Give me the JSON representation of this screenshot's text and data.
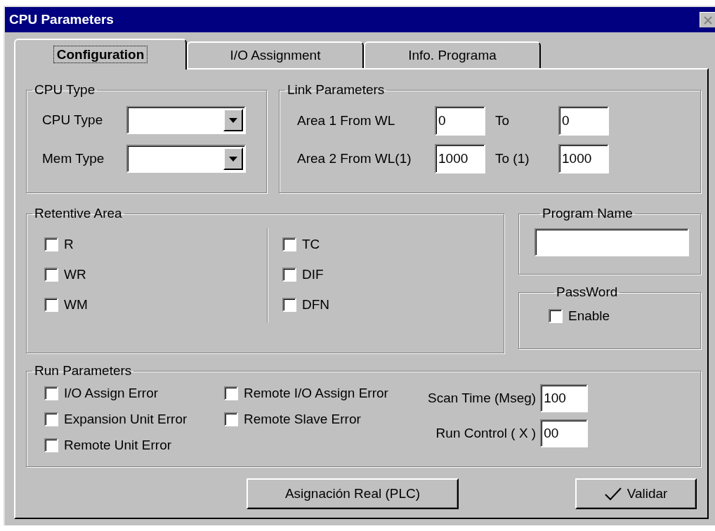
{
  "window": {
    "title": "CPU Parameters"
  },
  "tabs": [
    {
      "label": "Configuration",
      "selected": true
    },
    {
      "label": "I/O Assignment",
      "selected": false
    },
    {
      "label": "Info. Programa",
      "selected": false
    }
  ],
  "cpu_type": {
    "title": "CPU Type",
    "fields": [
      {
        "label": "CPU Type"
      },
      {
        "label": "Mem Type"
      }
    ]
  },
  "link_parameters": {
    "title": "Link Parameters",
    "rows": [
      {
        "label": "Area 1 From WL",
        "from": "0",
        "to_label": "To",
        "to": "0"
      },
      {
        "label": "Area 2 From WL(1)",
        "from": "1000",
        "to_label": "To (1)",
        "to": "1000"
      }
    ]
  },
  "retentive_area": {
    "title": "Retentive Area",
    "columns": [
      [
        {
          "label": "R",
          "checked": false
        },
        {
          "label": "WR",
          "checked": false
        },
        {
          "label": "WM",
          "checked": false
        }
      ],
      [
        {
          "label": "TC",
          "checked": false
        },
        {
          "label": "DIF",
          "checked": false
        },
        {
          "label": "DFN",
          "checked": false
        }
      ]
    ]
  },
  "program_name": {
    "title": "Program Name"
  },
  "password": {
    "title": "PassWord",
    "enable": {
      "label": "Enable",
      "checked": false
    }
  },
  "run_parameters": {
    "title": "Run Parameters",
    "columns": [
      [
        {
          "label": "I/O Assign Error",
          "checked": false
        },
        {
          "label": "Expansion Unit Error",
          "checked": false
        },
        {
          "label": "Remote Unit Error",
          "checked": false
        }
      ],
      [
        {
          "label": "Remote I/O Assign Error",
          "checked": false
        },
        {
          "label": "Remote Slave Error",
          "checked": false
        }
      ]
    ],
    "fields": [
      {
        "label": "Scan Time (Mseg)",
        "value": "100"
      },
      {
        "label": "Run Control ( X )",
        "value": "00"
      }
    ]
  },
  "buttons": [
    {
      "label": "Asignación Real (PLC)",
      "kind": "plain"
    },
    {
      "label": "Validar",
      "kind": "check"
    }
  ]
}
